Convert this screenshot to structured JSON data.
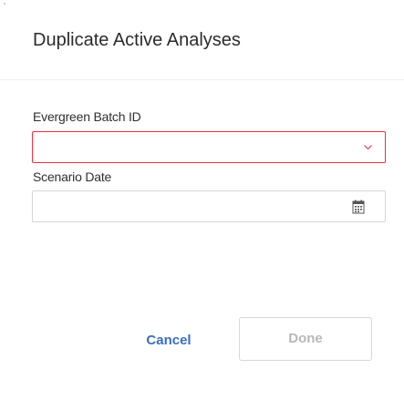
{
  "dialog": {
    "title": "Duplicate Active Analyses"
  },
  "fields": {
    "batch_id": {
      "label": "Evergreen Batch ID",
      "value": "",
      "icon": "chevron-down-icon",
      "state": "invalid",
      "border_color": "#e5333d"
    },
    "scenario_date": {
      "label": "Scenario Date",
      "value": "",
      "icon": "calendar-icon"
    }
  },
  "actions": {
    "cancel_label": "Cancel",
    "done_label": "Done",
    "done_disabled": true,
    "accent_color": "#3a6fbf"
  }
}
